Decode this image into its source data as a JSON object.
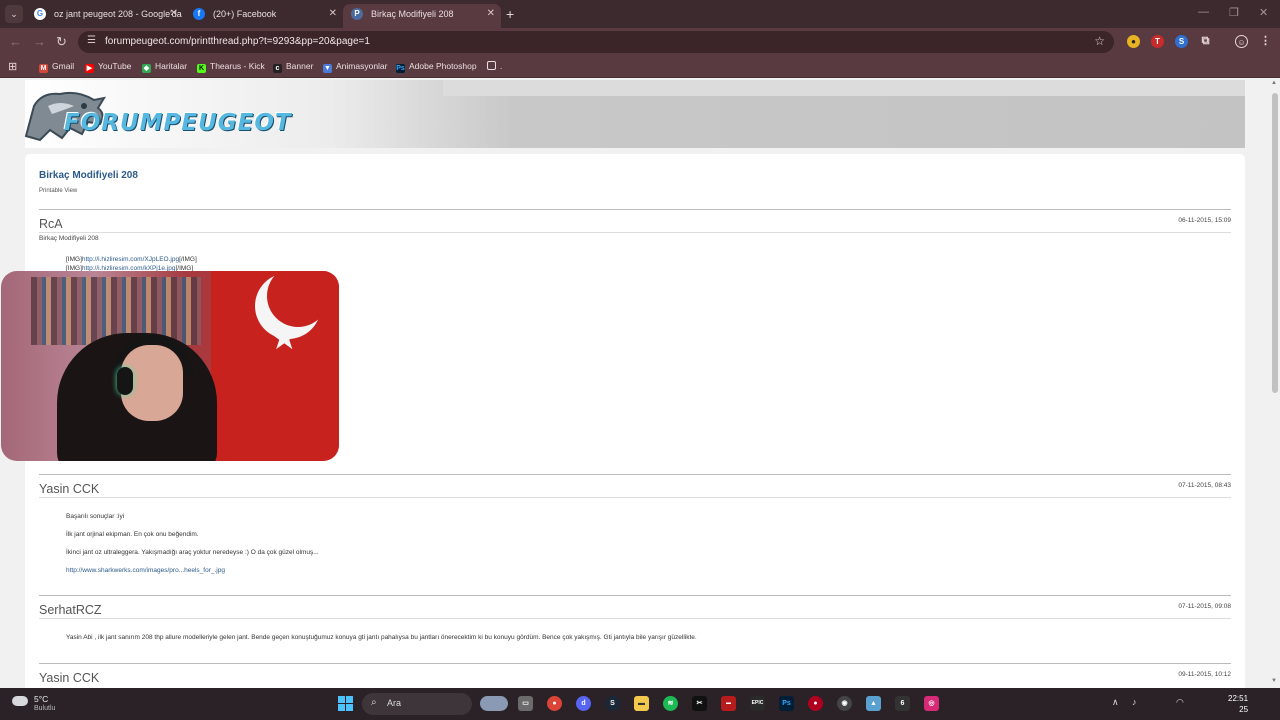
{
  "browser": {
    "tabs": [
      {
        "title": "oz jant peugeot 208 - Google'da",
        "icon": "G",
        "icon_color": "#ffffff",
        "active": false
      },
      {
        "title": "(20+) Facebook",
        "icon": "f",
        "icon_color": "#1877f2",
        "active": false
      },
      {
        "title": "Birkaç Modifiyeli 208",
        "icon": "P",
        "icon_color": "#4a6aa0",
        "active": true
      }
    ],
    "url": "forumpeugeot.com/printthread.php?t=9293&pp=20&page=1",
    "bookmarks": [
      "Gmail",
      "YouTube",
      "Haritalar",
      "Thearus - Kick",
      "Banner",
      "Animasyonlar",
      "Adobe Photoshop",
      "."
    ]
  },
  "page": {
    "logo_text": "FORUMPEUGEOT",
    "thread_title": "Birkaç Modifiyeli 208",
    "printable_view": "Printable View",
    "posts": [
      {
        "user": "RcA",
        "date": "06-11-2015, 15:09",
        "subtitle": "Birkaç Modifiyeli 208",
        "lines": [
          {
            "pre": "[IMG]",
            "link": "http://i.hizliresim.com/XJpLEO.jpg",
            "post": "[/IMG]"
          },
          {
            "pre": "[IMG]",
            "link": "http://i.hizliresim.com/kXPj1e.jpg",
            "post": "[/IMG]"
          }
        ]
      },
      {
        "user": "Yasin CCK",
        "date": "07-11-2015, 08:43",
        "lines": [
          {
            "text": "Başarılı sonuçlar :iyi"
          },
          {
            "text": "İlk jant orjinal ekipman. En çok onu beğendim."
          },
          {
            "text": "İkinci jant oz ultraleggera. Yakışmadığı araç yoktur neredeyse :) O da çok güzel olmuş..."
          },
          {
            "link": "http://www.sharkwerks.com/images/pro...heels_for_.jpg"
          }
        ]
      },
      {
        "user": "SerhatRCZ",
        "date": "07-11-2015, 09:08",
        "lines": [
          {
            "text": "Yasin Abi , ilk jant sanırım 208 thp allure modelleriyle gelen jant. Bende geçen konuştuğumuz konuya gti jantı pahalıysa bu jantları önerecektim ki bu konuyu gördüm. Bence çok yakışmış. Gti jantıyla bile yarışır güzellikte."
          }
        ]
      },
      {
        "user": "Yasin CCK",
        "date": "09-11-2015, 10:12",
        "lines": []
      }
    ]
  },
  "taskbar": {
    "temperature": "5°C",
    "weather": "Bulutlu",
    "search_label": "Ara",
    "time": "22:51",
    "date_fragment": "25"
  },
  "colors": {
    "chrome_dark": "#3c2a2e",
    "chrome_toolbar": "#5a3a41",
    "forum_link": "#2d5a8a",
    "logo_blue": "#56b8e0"
  },
  "icons": [
    "tab-search-icon",
    "back-arrow-icon",
    "forward-arrow-icon",
    "reload-icon",
    "site-settings-icon",
    "bookmark-star-icon",
    "extensions-icon",
    "profile-icon",
    "menu-dots-icon",
    "apps-grid-icon",
    "folder-icon",
    "windows-start-icon",
    "search-icon",
    "wifi-icon",
    "volume-icon"
  ]
}
